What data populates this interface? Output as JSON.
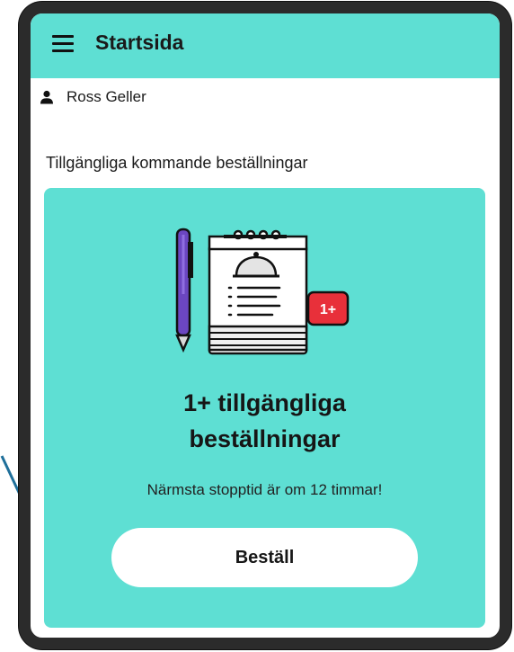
{
  "header": {
    "title": "Startsida",
    "menu_icon": "menu-icon"
  },
  "user": {
    "name": "Ross Geller",
    "icon": "person-icon"
  },
  "section": {
    "label": "Tillgängliga kommande beställningar"
  },
  "card": {
    "illustration": "order-notepad-illustration",
    "badge": "1+",
    "headline_line1": "1+ tillgängliga",
    "headline_line2": "beställningar",
    "subtext": "Närmsta stopptid är om 12 timmar!",
    "button_label": "Beställ"
  },
  "colors": {
    "accent": "#5edfd3",
    "badge": "#e8303a",
    "pen": "#6b46c1",
    "frame": "#2b2b2b",
    "annotation_arrow": "#1f6f9a"
  }
}
